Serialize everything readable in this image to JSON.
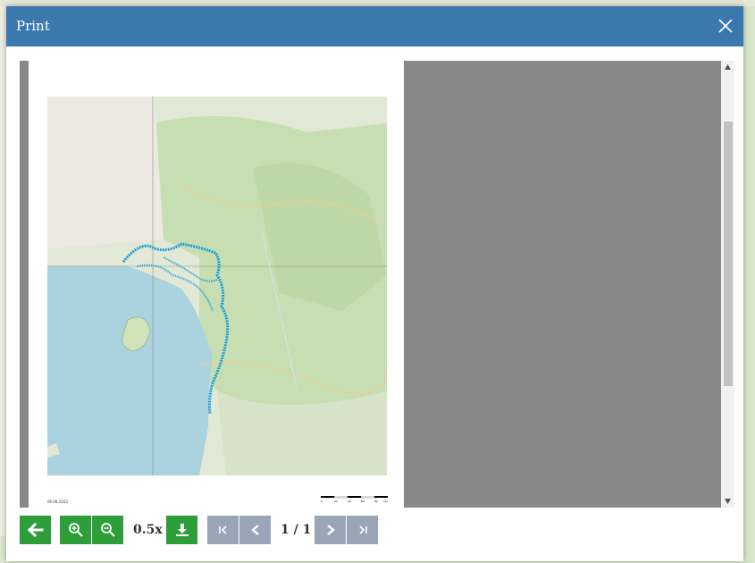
{
  "dialog": {
    "title": "Print"
  },
  "preview": {
    "print_date": "06.08.2023",
    "scale_labels": [
      "0",
      "20",
      "40",
      "60",
      "80",
      "100km"
    ]
  },
  "toolbar": {
    "zoom_level": "0.5x",
    "page_indicator": "1 / 1"
  },
  "icons": {
    "close": "close-icon",
    "back": "arrow-left-icon",
    "zoom_in": "zoom-in-icon",
    "zoom_out": "zoom-out-icon",
    "download": "download-icon",
    "first_page": "first-page-icon",
    "prev_page": "chevron-left-icon",
    "next_page": "chevron-right-icon",
    "last_page": "last-page-icon"
  },
  "colors": {
    "header": "#3a78ad",
    "button": "#2e9e3a",
    "button_disabled": "#9aa6b8",
    "viewer_bg": "#888888",
    "coastline_points": "#1a9ed8"
  }
}
